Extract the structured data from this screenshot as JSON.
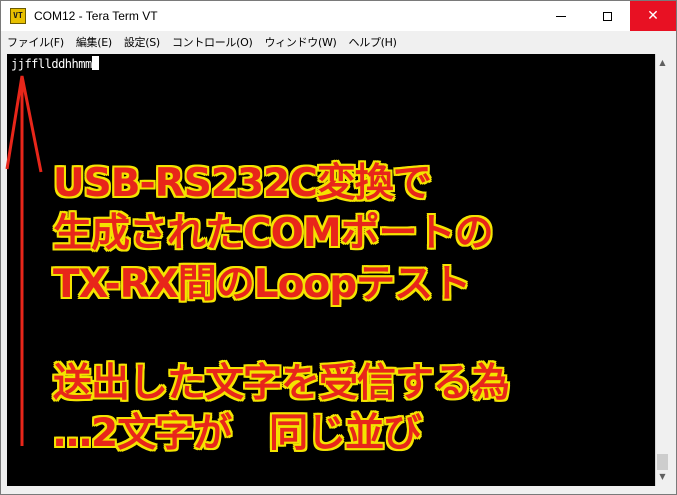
{
  "window": {
    "title": "COM12 - Tera Term VT",
    "icon_label": "VT",
    "controls": {
      "minimize": "minimize-icon",
      "maximize": "maximize-icon",
      "close": "✕"
    }
  },
  "menu": {
    "items": [
      {
        "label": "ファイル(F)"
      },
      {
        "label": "編集(E)"
      },
      {
        "label": "設定(S)"
      },
      {
        "label": "コントロール(O)"
      },
      {
        "label": "ウィンドウ(W)"
      },
      {
        "label": "ヘルプ(H)"
      }
    ]
  },
  "terminal": {
    "output": "jjffllddhhmm",
    "background": "#000000",
    "foreground": "#ffffff"
  },
  "annotation": {
    "lines": [
      "USB-RS232C変換で",
      "生成されたCOMポートの",
      "TX-RX間のLoopテスト",
      "送出した文字を受信する為",
      "…2文字が　同じ並び"
    ],
    "text_color": "#e8261a",
    "outline_color": "#f4e400",
    "arrow_color": "#e8261a"
  },
  "scrollbar": {
    "up": "▲",
    "down": "▼"
  }
}
